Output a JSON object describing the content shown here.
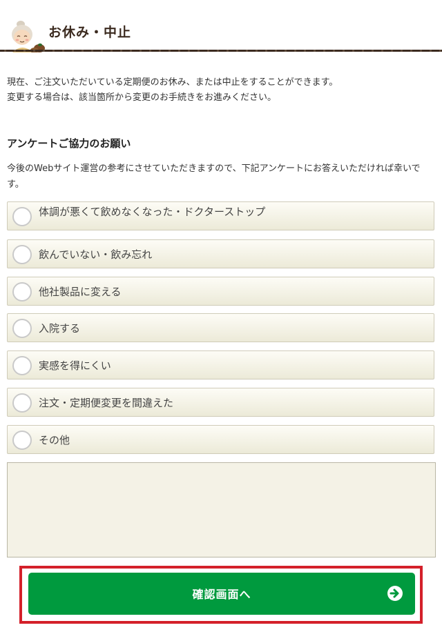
{
  "header": {
    "title": "お休み・中止"
  },
  "intro": {
    "line1": "現在、ご注文いただいている定期便のお休み、または中止をすることができます。",
    "line2": "変更する場合は、該当箇所から変更のお手続きをお進みください。"
  },
  "survey": {
    "heading": "アンケートご協力のお願い",
    "description": "今後のWebサイト運営の参考にさせていただきますので、下記アンケートにお答えいただければ幸いです。",
    "options": [
      {
        "label": "体調が悪くて飲めなくなった・ドクターストップ"
      },
      {
        "label": "飲んでいない・飲み忘れ"
      },
      {
        "label": "他社製品に変える"
      },
      {
        "label": "入院する"
      },
      {
        "label": "実感を得にくい"
      },
      {
        "label": "注文・定期便変更を間違えた"
      },
      {
        "label": "その他"
      }
    ],
    "notes_value": ""
  },
  "confirm": {
    "label": "確認画面へ",
    "icon": "arrow-circle-right-icon"
  },
  "colors": {
    "accent": "#009a3e",
    "highlight": "#d4202a",
    "option_bg": "#f4f2e6"
  }
}
